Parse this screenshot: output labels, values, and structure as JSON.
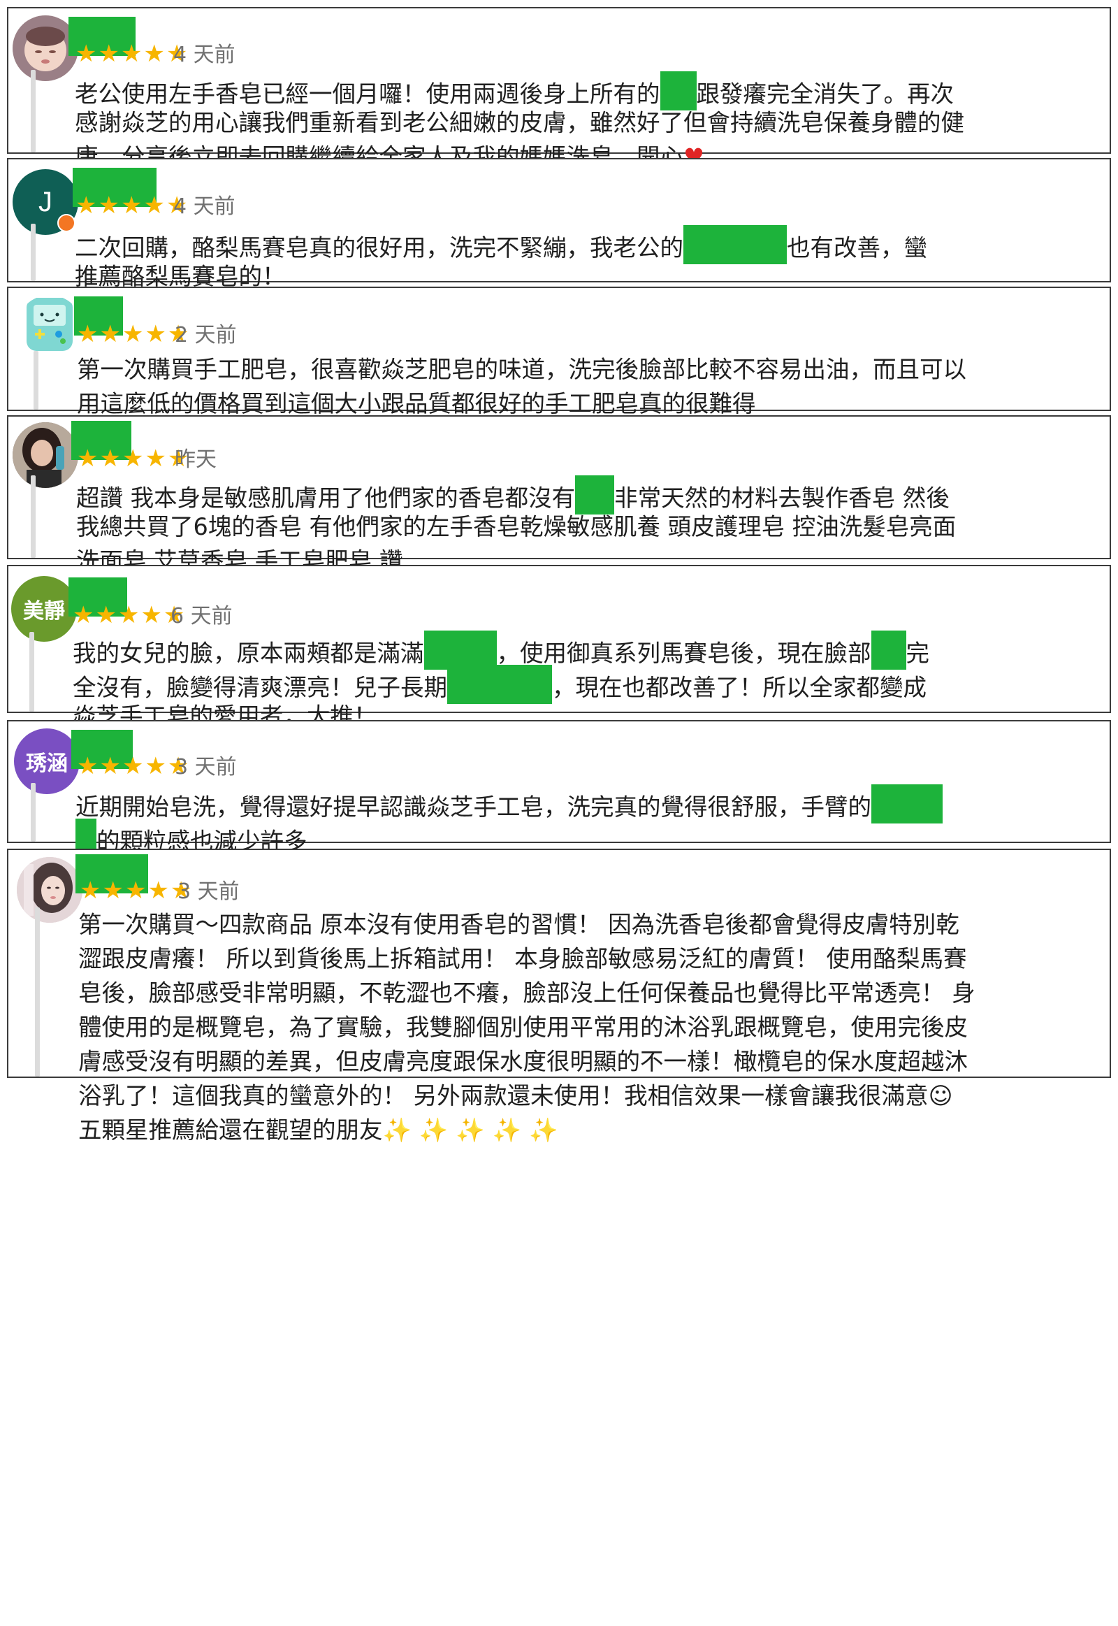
{
  "colors": {
    "redaction": "#1db33b",
    "star": "#f7b500",
    "card_border": "#3b3b3b"
  },
  "reviews": [
    {
      "avatar": {
        "type": "photo",
        "icon": "baby-photo",
        "bg": "#d8c7c0"
      },
      "rating": 5,
      "stars": "★★★★★",
      "time": "4 天前",
      "line1a": "老公使用左手香皂已經一個月囉！使用兩週後身上所有的",
      "line1b": "跟發癢完全消失了。再次",
      "line2": "感謝焱芝的用心讓我們重新看到老公細嫩的皮膚，雖然好了但會持續洗皂保養身體的健",
      "line3": "康。分享後立即去回購繼續給全家人及我的媽媽洗皂，開心",
      "heart": "♥"
    },
    {
      "avatar": {
        "type": "letter",
        "letter": "J",
        "bg": "#0f5f55"
      },
      "rating": 5,
      "stars": "★★★★★",
      "time": "4 天前",
      "line1a": "二次回購，酪梨馬賽皂真的很好用，洗完不緊繃，我老公的",
      "line1b": "也有改善，蠻",
      "line2": "推薦酪梨馬賽皂的！"
    },
    {
      "avatar": {
        "type": "icon",
        "icon": "bmo-robot-icon",
        "bg": "#7fd7d2"
      },
      "rating": 5,
      "stars": "★★★★★",
      "time": "2 天前",
      "line1": "第一次購買手工肥皂，很喜歡焱芝肥皂的味道，洗完後臉部比較不容易出油，而且可以",
      "line2": "用這麼低的價格買到這個大小跟品質都很好的手工肥皂真的很難得"
    },
    {
      "avatar": {
        "type": "photo",
        "icon": "woman-photo",
        "bg": "#6a5a52"
      },
      "rating": 5,
      "stars": "★★★★★",
      "time": "昨天",
      "line1a": "超讚 我本身是敏感肌膚用了他們家的香皂都沒有",
      "line1b": "非常天然的材料去製作香皂 然後",
      "line2": "我總共買了6塊的香皂 有他們家的左手香皂乾燥敏感肌養 頭皮護理皂 控油洗髮皂亮面",
      "line3": "洗面皂 艾草香皂 手工皂肥皂 讚"
    },
    {
      "avatar": {
        "type": "letter",
        "letter": "美靜",
        "bg": "#6a9a2c"
      },
      "rating": 5,
      "stars": "★★★★★",
      "time": "6 天前",
      "line1a": "我的女兒的臉，原本兩頰都是滿滿",
      "line1b": "，使用御真系列馬賽皂後，現在臉部",
      "line1c": "完",
      "line2a": "全沒有，臉變得清爽漂亮！兒子長期",
      "line2b": "，現在也都改善了！所以全家都變成",
      "line3": "焱芝手工皂的愛用者，大推！"
    },
    {
      "avatar": {
        "type": "letter",
        "letter": "琇涵",
        "bg": "#7a4fc2"
      },
      "rating": 5,
      "stars": "★★★★★",
      "time": "3 天前",
      "line1": "近期開始皂洗，覺得還好提早認識焱芝手工皂，洗完真的覺得很舒服，手臂的",
      "line2": "的顆粒感也減少許多"
    },
    {
      "avatar": {
        "type": "photo",
        "icon": "girl-photo",
        "bg": "#d9c4c8"
      },
      "rating": 5,
      "stars": "★★★★★",
      "time": "3 天前",
      "line1": "第一次購買～四款商品 原本沒有使用香皂的習慣！ 因為洗香皂後都會覺得皮膚特別乾",
      "line2": "澀跟皮膚癢！ 所以到貨後馬上拆箱試用！ 本身臉部敏感易泛紅的膚質！ 使用酪梨馬賽",
      "line3": "皂後，臉部感受非常明顯，不乾澀也不癢，臉部沒上任何保養品也覺得比平常透亮！ 身",
      "line4": "體使用的是概覽皂，為了實驗，我雙腳個別使用平常用的沐浴乳跟概覽皂，使用完後皮",
      "line5": "膚感受沒有明顯的差異，但皮膚亮度跟保水度很明顯的不一樣！橄欖皂的保水度超越沐",
      "line6": "浴乳了！這個我真的蠻意外的！ 另外兩款還未使用！我相信效果一樣會讓我很滿意☺",
      "line7": "五顆星推薦給還在觀望的朋友",
      "sparkles": "✨ ✨ ✨ ✨ ✨"
    }
  ]
}
